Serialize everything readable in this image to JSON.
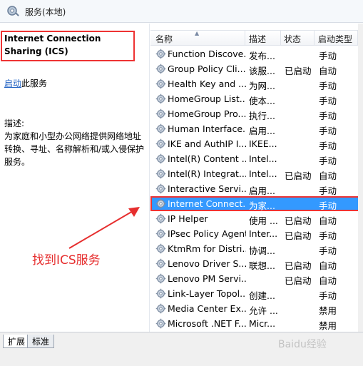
{
  "window": {
    "title": "服务(本地)"
  },
  "detail": {
    "service_title": "Internet Connection Sharing (ICS)",
    "start_link": "启动",
    "start_suffix": "此服务",
    "desc_label": "描述:",
    "desc_text": "为家庭和小型办公网络提供网络地址转换、寻址、名称解析和/或入侵保护服务。"
  },
  "table": {
    "headers": {
      "name": "名称",
      "desc": "描述",
      "status": "状态",
      "type": "启动类型"
    },
    "rows": [
      {
        "name": "Function Discove...",
        "desc": "发布...",
        "status": "",
        "type": "手动"
      },
      {
        "name": "Group Policy Cli...",
        "desc": "该服...",
        "status": "已启动",
        "type": "自动"
      },
      {
        "name": "Health Key and ...",
        "desc": "为网...",
        "status": "",
        "type": "手动"
      },
      {
        "name": "HomeGroup List...",
        "desc": "使本...",
        "status": "",
        "type": "手动"
      },
      {
        "name": "HomeGroup Pro...",
        "desc": "执行...",
        "status": "",
        "type": "手动"
      },
      {
        "name": "Human Interface...",
        "desc": "启用...",
        "status": "",
        "type": "手动"
      },
      {
        "name": "IKE and AuthIP I...",
        "desc": "IKEE...",
        "status": "",
        "type": "手动"
      },
      {
        "name": "Intel(R) Content ...",
        "desc": "Intel...",
        "status": "",
        "type": "手动"
      },
      {
        "name": "Intel(R) Integrat...",
        "desc": "Intel...",
        "status": "已启动",
        "type": "自动"
      },
      {
        "name": "Interactive Servi...",
        "desc": "启用...",
        "status": "",
        "type": "手动"
      },
      {
        "name": "Internet Connect...",
        "desc": "为家...",
        "status": "",
        "type": "手动"
      },
      {
        "name": "IP Helper",
        "desc": "使用 ...",
        "status": "已启动",
        "type": "自动"
      },
      {
        "name": "IPsec Policy Agent",
        "desc": "Inter...",
        "status": "已启动",
        "type": "手动"
      },
      {
        "name": "KtmRm for Distri...",
        "desc": "协调...",
        "status": "",
        "type": "手动"
      },
      {
        "name": "Lenovo Driver S...",
        "desc": "联想...",
        "status": "已启动",
        "type": "自动"
      },
      {
        "name": "Lenovo PM Servi...",
        "desc": "",
        "status": "已启动",
        "type": "自动"
      },
      {
        "name": "Link-Layer Topol...",
        "desc": "创建...",
        "status": "",
        "type": "手动"
      },
      {
        "name": "Media Center Ex...",
        "desc": "允许 ...",
        "status": "",
        "type": "禁用"
      },
      {
        "name": "Microsoft .NET F...",
        "desc": "Micr...",
        "status": "",
        "type": "禁用"
      }
    ],
    "selected_index": 10
  },
  "tabs": [
    {
      "label": "扩展"
    },
    {
      "label": "标准"
    }
  ],
  "annotation": {
    "text": "找到ICS服务"
  },
  "watermark": {
    "text": "Baidu经验"
  },
  "colors": {
    "selection": "#3399ff",
    "highlight_box": "#ee3333",
    "link": "#1d5fc2"
  }
}
